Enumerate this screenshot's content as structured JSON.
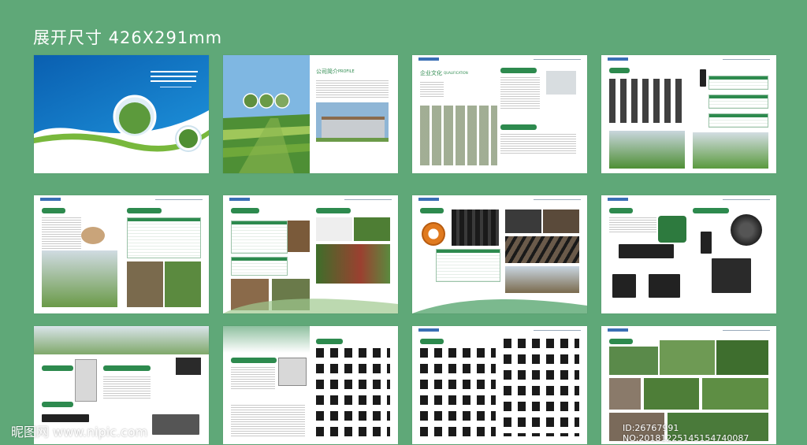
{
  "header": {
    "title": "展开尺寸 426X291mm"
  },
  "page2": {
    "heading": "公司简介",
    "heading_en": "PROFILE"
  },
  "page3": {
    "heading": "企业文化",
    "heading_en": "QUALIFICATION"
  },
  "watermark": {
    "site": "昵图网 www.nipic.com",
    "id": "ID:26767991 NO:20181225145154740087"
  },
  "colors": {
    "background": "#5fa878",
    "accent": "#2d8a4e",
    "blue": "#1f6fc0"
  }
}
